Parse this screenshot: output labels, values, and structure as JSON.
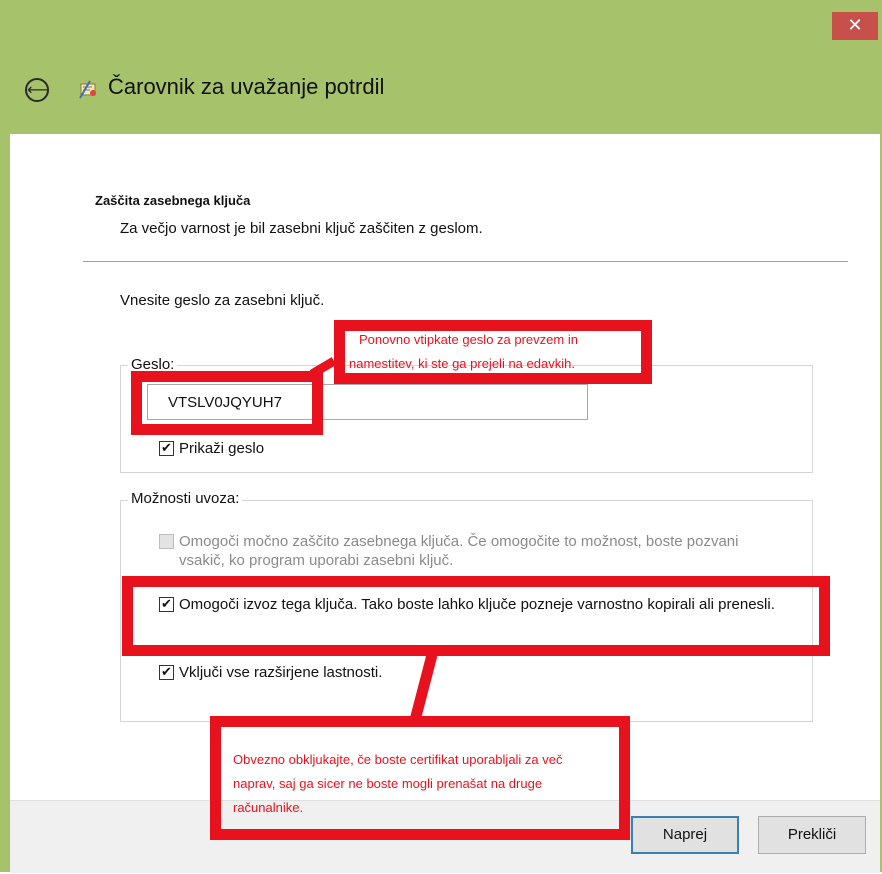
{
  "window": {
    "close_glyph": "✕",
    "back_glyph": "⟵",
    "title": "Čarovnik za uvažanje potrdil"
  },
  "header": {
    "section_title": "Zaščita zasebnega ključa",
    "section_subtitle": "Za večjo varnost je bil zasebni ključ zaščiten z geslom."
  },
  "form": {
    "prompt": "Vnesite geslo za zasebni ključ.",
    "password_group_label": "Geslo:",
    "password_value": "VTSLV0JQYUH7",
    "show_password_label": "Prikaži geslo",
    "show_password_checked": true,
    "import_options_label": "Možnosti uvoza:",
    "options": [
      {
        "label": "Omogoči močno zaščito zasebnega ključa. Če omogočite to možnost, boste pozvani vsakič, ko program uporabi zasebni ključ.",
        "checked": false,
        "enabled": false
      },
      {
        "label": "Omogoči izvoz tega ključa. Tako boste lahko ključe pozneje varnostno kopirali ali prenesli.",
        "checked": true,
        "enabled": true
      },
      {
        "label": "Vključi vse razširjene lastnosti.",
        "checked": true,
        "enabled": true
      }
    ]
  },
  "annotations": {
    "password_note_line1": "Ponovno vtipkate geslo za prevzem in",
    "password_note_line2": "namestitev, ki ste ga prejeli na edavkih.",
    "export_note_line1": "Obvezno obkljukajte, če boste certifikat uporabljali za več",
    "export_note_line2": "naprav, saj ga sicer ne boste mogli prenašat na druge",
    "export_note_line3": "računalnike.",
    "color": "#e8121f"
  },
  "footer": {
    "next_label": "Naprej",
    "cancel_label": "Prekliči"
  },
  "colors": {
    "titlebar": "#a6c26a",
    "close_button": "#c7504b",
    "default_button_border": "#3c7fb1"
  }
}
